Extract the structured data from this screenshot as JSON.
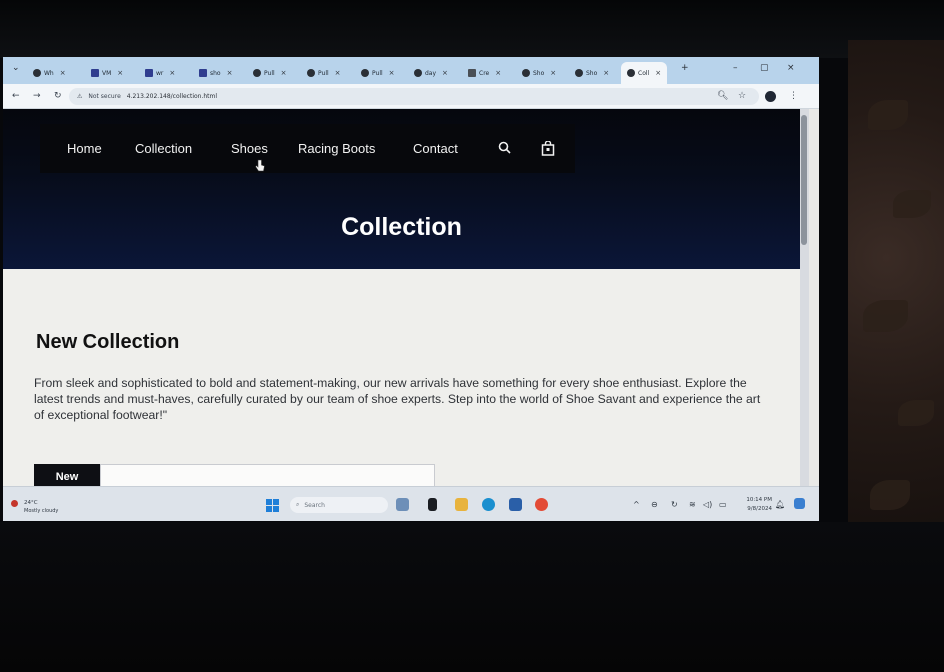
{
  "browser": {
    "tabs": [
      {
        "label": "Wh"
      },
      {
        "label": "VM"
      },
      {
        "label": "wr"
      },
      {
        "label": "sho"
      },
      {
        "label": "Pull"
      },
      {
        "label": "Pull"
      },
      {
        "label": "Pull"
      },
      {
        "label": "day"
      },
      {
        "label": "Cre"
      },
      {
        "label": "Sho"
      },
      {
        "label": "Sho"
      },
      {
        "label": "Coll"
      }
    ],
    "new_tab": "+",
    "window_controls": {
      "minimize": "–",
      "restore": "▢",
      "close": "×"
    },
    "address": {
      "security": "Not secure",
      "url": "4.213.202.148/collection.html"
    }
  },
  "site": {
    "nav": {
      "home": "Home",
      "collection": "Collection",
      "shoes": "Shoes",
      "racing_boots": "Racing Boots",
      "contact": "Contact"
    },
    "hero_title": "Collection",
    "section": {
      "title": "New Collection",
      "body": "From sleek and sophisticated to bold and statement-making, our new arrivals have something for every shoe enthusiast. Explore the latest trends and must-haves, carefully curated by our team of shoe experts. Step into the world of Shoe Savant and experience the art of exceptional footwear!\"",
      "tab_new": "New"
    }
  },
  "taskbar": {
    "weather_temp": "24°C",
    "weather_desc": "Mostly cloudy",
    "search_placeholder": "Search",
    "time": "10:14 PM",
    "date": "9/8/2024"
  }
}
